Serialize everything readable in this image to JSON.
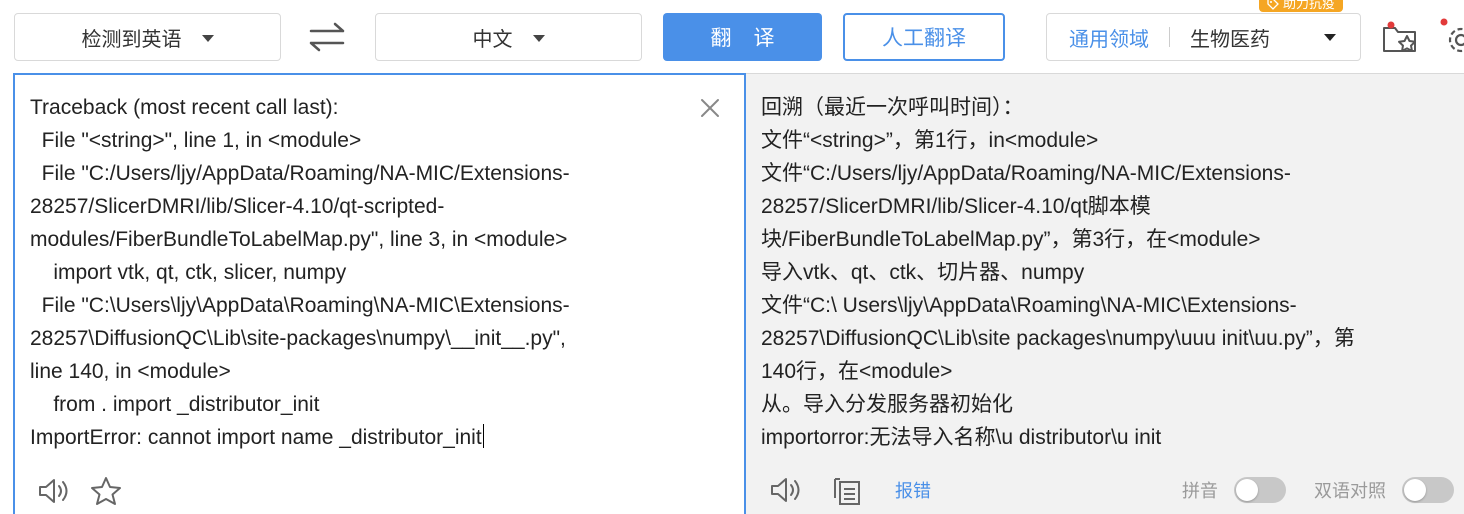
{
  "toolbar": {
    "source_language": "检测到英语",
    "target_language": "中文",
    "translate_button": "翻译",
    "human_translate_button": "人工翻译",
    "domain_label": "通用领域",
    "domain_value": "生物医药",
    "badge": "助力抗疫",
    "icons": [
      "swap-languages-icon",
      "favorites-folder-icon",
      "settings-gear-icon"
    ],
    "accent_color": "#4a90e8",
    "badge_color": "#f5a623"
  },
  "source": {
    "lines": [
      "Traceback (most recent call last):",
      "  File \"<string>\", line 1, in <module>",
      "  File \"C:/Users/ljy/AppData/Roaming/NA-MIC/Extensions-",
      "28257/SlicerDMRI/lib/Slicer-4.10/qt-scripted-",
      "modules/FiberBundleToLabelMap.py\", line 3, in <module>",
      "    import vtk, qt, ctk, slicer, numpy",
      "  File \"C:\\Users\\ljy\\AppData\\Roaming\\NA-MIC\\Extensions-",
      "28257\\DiffusionQC\\Lib\\site-packages\\numpy\\__init__.py\",",
      "line 140, in <module>",
      "    from . import _distributor_init",
      "ImportError: cannot import name _distributor_init"
    ],
    "icons": [
      "close-icon",
      "speaker-icon",
      "star-icon"
    ]
  },
  "target": {
    "lines": [
      "回溯（最近一次呼叫时间）：",
      "文件“<string>”，第1行，in<module>",
      "文件“C:/Users/ljy/AppData/Roaming/NA-MIC/Extensions-",
      "28257/SlicerDMRI/lib/Slicer-4.10/qt脚本模",
      "块/FiberBundleToLabelMap.py”，第3行，在<module>",
      "导入vtk、qt、ctk、切片器、numpy",
      "文件“C:\\ Users\\ljy\\AppData\\Roaming\\NA-MIC\\Extensions-",
      "28257\\DiffusionQC\\Lib\\site packages\\numpy\\uuu init\\uu.py”，第",
      "140行，在<module>",
      "从。导入分发服务器初始化",
      "importorror:无法导入名称\\u distributor\\u init"
    ],
    "report_link": "报错",
    "pinyin_label": "拼音",
    "bilingual_label": "双语对照",
    "pinyin_enabled": false,
    "bilingual_enabled": false,
    "icons": [
      "speaker-icon",
      "copy-icon"
    ]
  }
}
